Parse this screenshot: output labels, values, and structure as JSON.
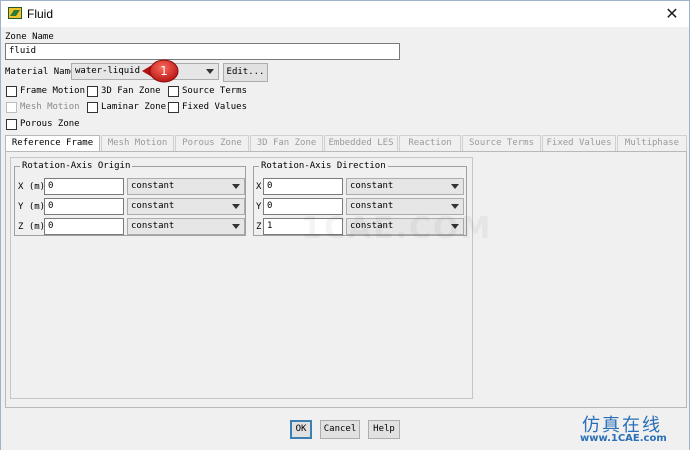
{
  "window": {
    "title": "Fluid",
    "close_glyph": "✕"
  },
  "zone": {
    "label": "Zone Name",
    "value": "fluid"
  },
  "material": {
    "label": "Material Name",
    "value": "water-liquid",
    "edit_label": "Edit...",
    "callout_number": "1",
    "callout_color": "#d21f1f"
  },
  "checkboxes": {
    "frame_motion": "Frame Motion",
    "fan_zone": "3D Fan Zone",
    "source_terms": "Source Terms",
    "mesh_motion": "Mesh Motion",
    "laminar_zone": "Laminar Zone",
    "fixed_values": "Fixed Values",
    "porous_zone": "Porous Zone"
  },
  "tabs": [
    {
      "label": "Reference Frame",
      "active": true
    },
    {
      "label": "Mesh Motion"
    },
    {
      "label": "Porous Zone"
    },
    {
      "label": "3D Fan Zone"
    },
    {
      "label": "Embedded LES"
    },
    {
      "label": "Reaction"
    },
    {
      "label": "Source Terms"
    },
    {
      "label": "Fixed Values"
    },
    {
      "label": "Multiphase"
    }
  ],
  "origin": {
    "title": "Rotation-Axis Origin",
    "rows": [
      {
        "label": "X (m)",
        "value": "0",
        "method": "constant"
      },
      {
        "label": "Y (m)",
        "value": "0",
        "method": "constant"
      },
      {
        "label": "Z (m)",
        "value": "0",
        "method": "constant"
      }
    ]
  },
  "direction": {
    "title": "Rotation-Axis Direction",
    "rows": [
      {
        "label": "X",
        "value": "0",
        "method": "constant"
      },
      {
        "label": "Y",
        "value": "0",
        "method": "constant"
      },
      {
        "label": "Z",
        "value": "1",
        "method": "constant"
      }
    ]
  },
  "buttons": {
    "ok": "OK",
    "cancel": "Cancel",
    "help": "Help"
  },
  "watermark": {
    "cn": "仿真在线",
    "url": "www.1CAE.com",
    "center": "1CAE.COM"
  },
  "colors": {
    "accent": "#3c7fb1",
    "watermark": "#2a6fb7"
  }
}
